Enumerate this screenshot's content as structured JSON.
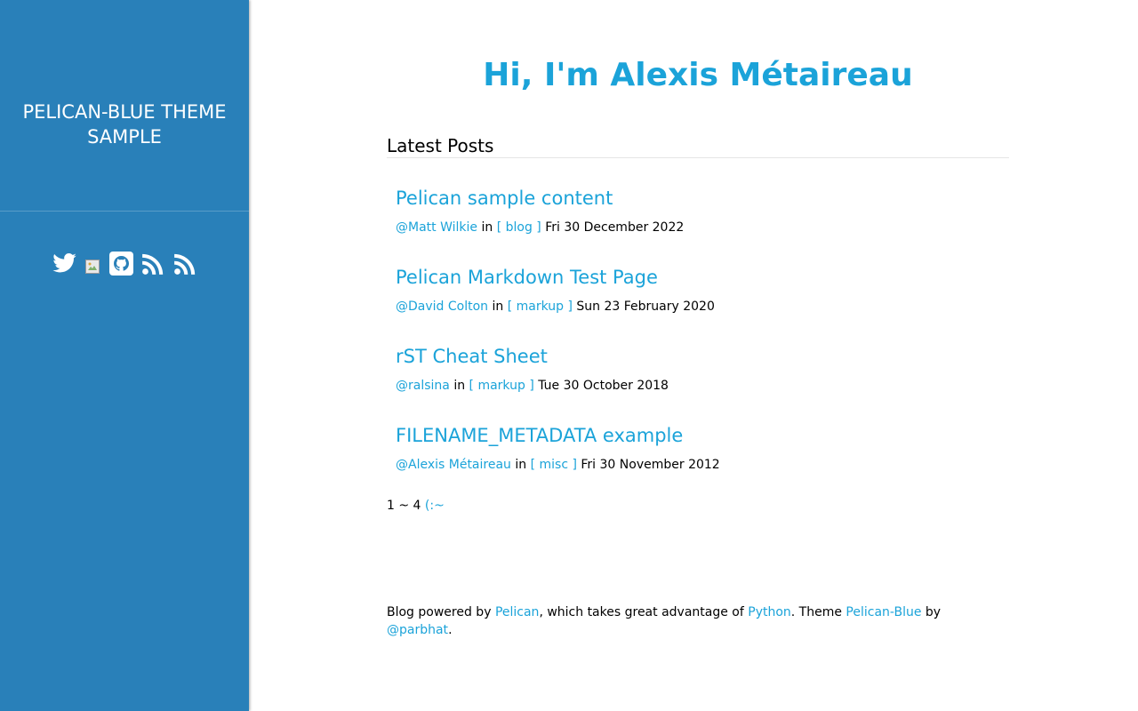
{
  "sidebar": {
    "site_title": "PELICAN-BLUE THEME SAMPLE",
    "social_icons": [
      "twitter-icon",
      "broken-image-icon",
      "github-icon",
      "rss-icon",
      "rss-icon"
    ],
    "background": "#2980b9"
  },
  "main": {
    "hero": "Hi, I'm Alexis Métaireau",
    "section_title": "Latest Posts",
    "posts": [
      {
        "title": "Pelican sample content",
        "author": "@Matt Wilkie",
        "in": "in",
        "category": "[ blog ]",
        "date": "Fri 30 December 2022"
      },
      {
        "title": "Pelican Markdown Test Page",
        "author": "@David Colton",
        "in": "in",
        "category": "[ markup ]",
        "date": "Sun 23 February 2020"
      },
      {
        "title": "rST Cheat Sheet",
        "author": "@ralsina",
        "in": "in",
        "category": "[ markup ]",
        "date": "Tue 30 October 2018"
      },
      {
        "title": "FILENAME_METADATA example",
        "author": "@Alexis Métaireau",
        "in": "in",
        "category": "[ misc ]",
        "date": "Fri 30 November 2012"
      }
    ],
    "pager": {
      "range": "1 ~ 4",
      "next": "(:~"
    }
  },
  "footer": {
    "t1": "Blog powered by ",
    "pelican": "Pelican",
    "t2": ", which takes great advantage of ",
    "python": "Python",
    "t3": ". Theme ",
    "theme": "Pelican-Blue",
    "t4": " by ",
    "author": "@parbhat",
    "t5": "."
  },
  "colors": {
    "accent": "#1ba3d9",
    "sidebar": "#2980b9"
  }
}
